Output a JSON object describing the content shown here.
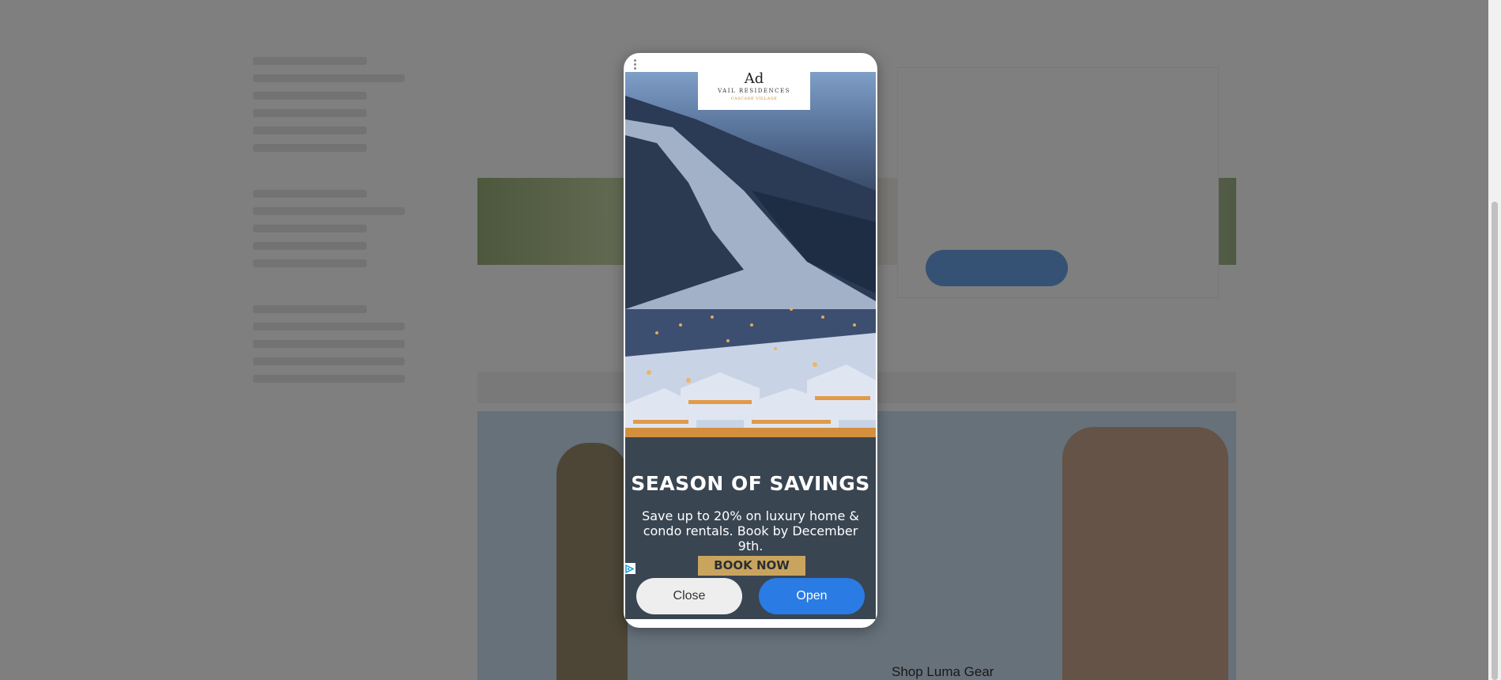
{
  "background_page": {
    "shop_link_label": "Shop Luma Gear"
  },
  "ad": {
    "badge_label": "Ad",
    "brand_name": "VAIL RESIDENCES",
    "brand_sub": "CASCADE VILLAGE",
    "headline": "SEASON OF SAVINGS",
    "body": "Save up to 20% on luxury home & condo rentals. Book by December 9th.",
    "cta_label": "BOOK NOW",
    "close_label": "Close",
    "open_label": "Open",
    "colors": {
      "cta": "#c9a45f",
      "open_button": "#2a7be4",
      "creative_panel": "#3a4552"
    },
    "icons": [
      "more-options-icon",
      "adchoices-icon"
    ]
  }
}
